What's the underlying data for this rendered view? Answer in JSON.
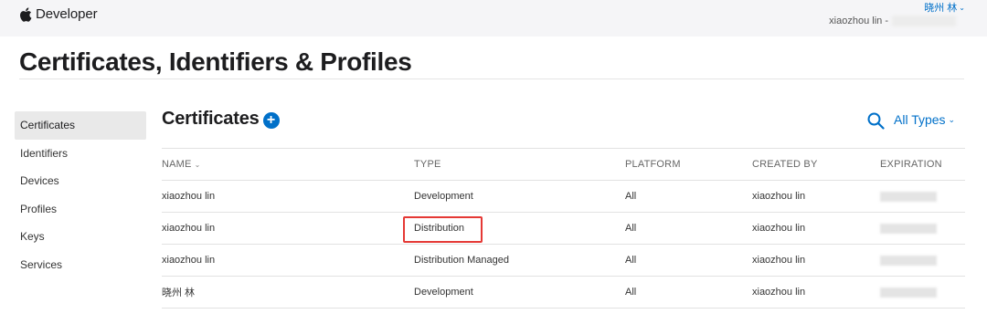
{
  "header": {
    "brand": "Developer",
    "account_name": "晓州 林",
    "account_line": "xiaozhou lin -"
  },
  "page_title": "Certificates, Identifiers & Profiles",
  "sidebar": {
    "items": [
      {
        "label": "Certificates",
        "active": true
      },
      {
        "label": "Identifiers",
        "active": false
      },
      {
        "label": "Devices",
        "active": false
      },
      {
        "label": "Profiles",
        "active": false
      },
      {
        "label": "Keys",
        "active": false
      },
      {
        "label": "Services",
        "active": false
      }
    ]
  },
  "section": {
    "title": "Certificates",
    "add_icon": "plus-circle-icon",
    "search_icon": "search-icon",
    "filter_label": "All Types"
  },
  "table": {
    "columns": [
      "NAME",
      "TYPE",
      "PLATFORM",
      "CREATED BY",
      "EXPIRATION"
    ],
    "rows": [
      {
        "name": "xiaozhou lin",
        "type": "Development",
        "platform": "All",
        "created_by": "xiaozhou lin"
      },
      {
        "name": "xiaozhou lin",
        "type": "Distribution",
        "platform": "All",
        "created_by": "xiaozhou lin"
      },
      {
        "name": "xiaozhou lin",
        "type": "Distribution Managed",
        "platform": "All",
        "created_by": "xiaozhou lin"
      },
      {
        "name": "晓州 林",
        "type": "Development",
        "platform": "All",
        "created_by": "xiaozhou lin"
      }
    ]
  },
  "colors": {
    "accent": "#0070c9",
    "highlight": "#e53935"
  }
}
